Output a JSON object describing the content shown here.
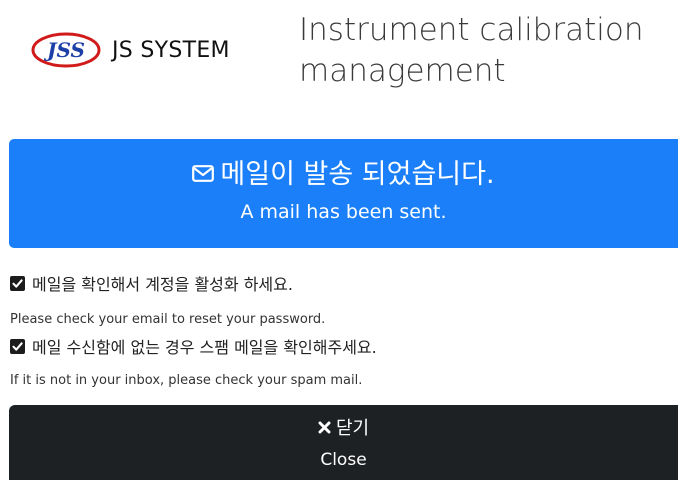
{
  "header": {
    "logo_text": "JS SYSTEM",
    "title_line1": "Instrument calibration",
    "title_line2": "management"
  },
  "alert": {
    "icon": "envelope-icon",
    "message_kr": "메일이 발송 되었습니다.",
    "message_en": "A mail has been sent.",
    "background": "#1a7ff8"
  },
  "notes": [
    {
      "icon": "checkbox-checked-icon",
      "text_kr": "메일을 확인해서 계정을 활성화 하세요.",
      "text_en": "Please check your email to reset your password."
    },
    {
      "icon": "checkbox-checked-icon",
      "text_kr": "메일 수신함에 없는 경우 스팸 메일을 확인해주세요.",
      "text_en": "If it is not in your inbox, please check your spam mail."
    }
  ],
  "close_button": {
    "icon": "close-x-icon",
    "label_kr": "닫기",
    "label_en": "Close",
    "background": "#1e2124"
  }
}
